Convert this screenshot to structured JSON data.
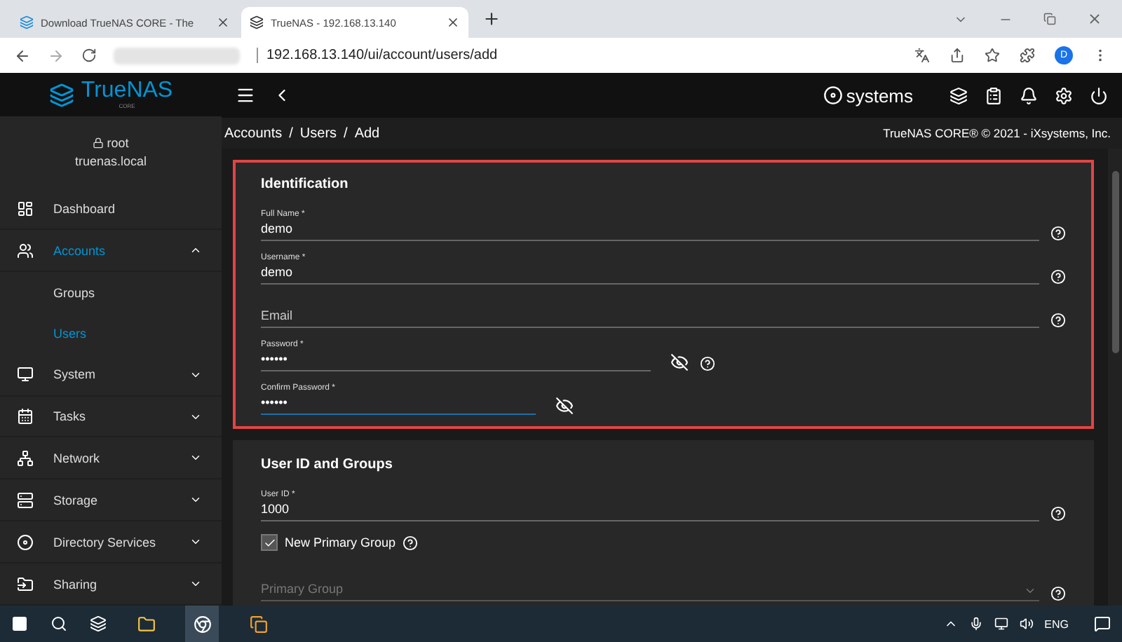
{
  "browser": {
    "tabs": [
      {
        "title": "Download TrueNAS CORE - The",
        "selected": false
      },
      {
        "title": "TrueNAS - 192.168.13.140",
        "selected": true
      }
    ],
    "address": "192.168.13.140/ui/account/users/add",
    "profile": "D"
  },
  "header": {
    "logo": "TrueNAS",
    "logo_sub": "CORE",
    "brand": "systems"
  },
  "sidebar": {
    "user": "root",
    "host": "truenas.local",
    "items": [
      {
        "label": "Dashboard",
        "selected": false
      },
      {
        "label": "Accounts",
        "selected": true,
        "expanded": true,
        "children": [
          {
            "label": "Groups",
            "selected": false
          },
          {
            "label": "Users",
            "selected": true
          }
        ]
      },
      {
        "label": "System",
        "selected": false,
        "expanded": false
      },
      {
        "label": "Tasks",
        "selected": false,
        "expanded": false
      },
      {
        "label": "Network",
        "selected": false,
        "expanded": false
      },
      {
        "label": "Storage",
        "selected": false,
        "expanded": false
      },
      {
        "label": "Directory Services",
        "selected": false,
        "expanded": false
      },
      {
        "label": "Sharing",
        "selected": false,
        "expanded": false
      }
    ]
  },
  "breadcrumb": [
    "Accounts",
    "/",
    "Users",
    "/",
    "Add"
  ],
  "copyright": "TrueNAS CORE® © 2021 - iXsystems, Inc.",
  "sections": [
    {
      "title": "Identification",
      "highlighted": true,
      "fields": [
        {
          "kind": "text",
          "label": "Full Name *",
          "value": "demo",
          "help": true,
          "focused": false
        },
        {
          "kind": "text",
          "label": "Username *",
          "value": "demo",
          "help": true,
          "focused": false
        },
        {
          "kind": "text",
          "placeholder": "Email",
          "help": true,
          "focused": false
        },
        {
          "kind": "password",
          "label": "Password *",
          "value": "••••••",
          "help": true,
          "focused": false
        },
        {
          "kind": "password",
          "label": "Confirm Password *",
          "value": "••••••",
          "help": false,
          "focused": true
        }
      ]
    },
    {
      "title": "User ID and Groups",
      "highlighted": false,
      "fields": [
        {
          "kind": "text",
          "label": "User ID *",
          "value": "1000",
          "help": true,
          "focused": false
        },
        {
          "kind": "checkbox",
          "label": "New Primary Group",
          "checked": true,
          "help": true
        },
        {
          "kind": "select",
          "placeholder": "Primary Group",
          "help": true,
          "focused": false
        }
      ]
    }
  ],
  "taskbar": {
    "language": "ENG"
  }
}
